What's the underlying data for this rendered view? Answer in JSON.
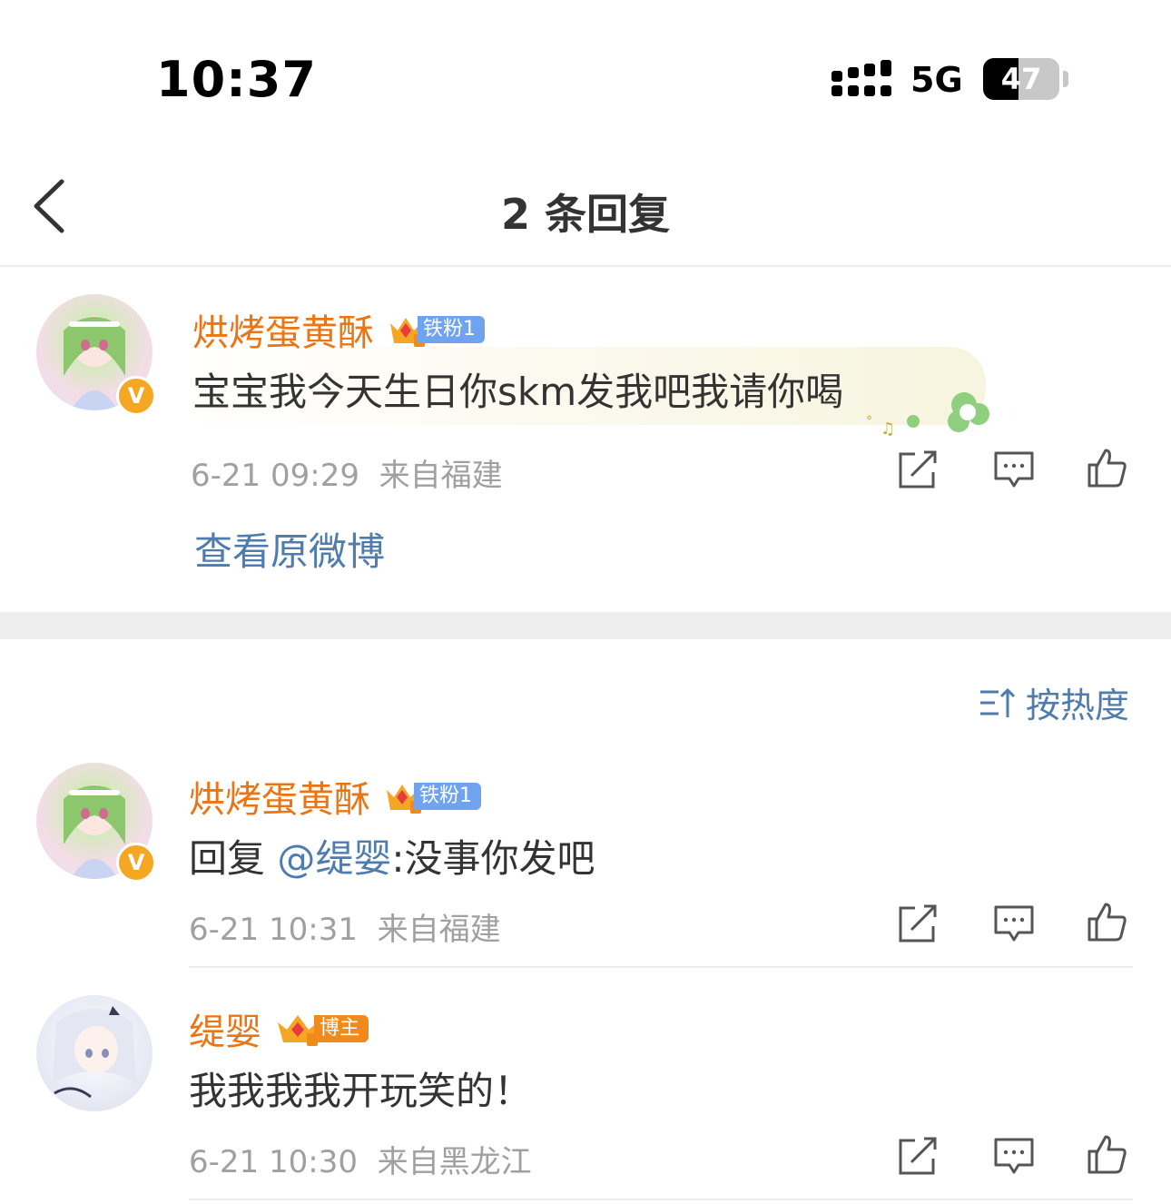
{
  "status_bar": {
    "time": "10:37",
    "network": "5G",
    "battery": "47",
    "battery_level": 0.47
  },
  "nav": {
    "title": "2 条回复"
  },
  "main_comment": {
    "user": "烘烤蛋黄酥",
    "fan_badge": "铁粉1",
    "content": "宝宝我今天生日你skm发我吧我请你喝",
    "time": "6-21 09:29",
    "location": "来自福建",
    "view_original": "查看原微博"
  },
  "sort_label": "按热度",
  "replies": [
    {
      "user": "烘烤蛋黄酥",
      "fan_badge": "铁粉1",
      "reply_prefix": "回复 ",
      "mention": "@缇婴",
      "content": ":没事你发吧",
      "time": "6-21 10:31",
      "location": "来自福建"
    },
    {
      "user": "缇婴",
      "fan_badge": "博主",
      "content": "我我我我开玩笑的！",
      "time": "6-21 10:30",
      "location": "来自黑龙江"
    }
  ],
  "colors": {
    "username": "#eb7413",
    "link": "#4f7cae",
    "meta": "#a0a0a0",
    "fan_tag": "#6fa3f0",
    "host_tag": "#f08a1c"
  },
  "icons": [
    "back-chevron-icon",
    "signal-icon",
    "crown-badge-icon",
    "verified-v-icon",
    "repost-icon",
    "comment-icon",
    "like-icon",
    "sort-icon"
  ]
}
